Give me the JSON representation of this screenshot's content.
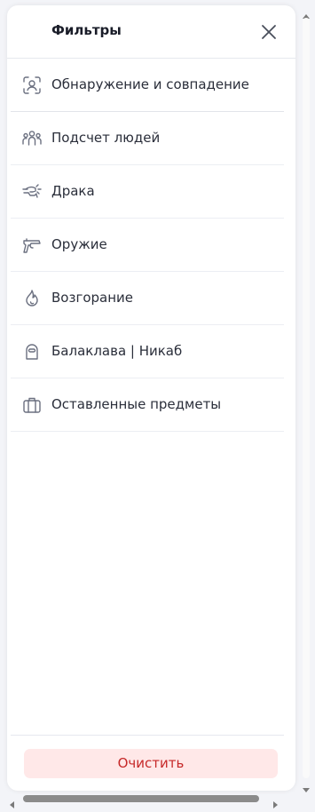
{
  "panel": {
    "title": "Фильтры",
    "close_icon": "close-icon"
  },
  "filters": [
    {
      "label": "Обнаружение и совпадение",
      "icon": "face-scan-icon"
    },
    {
      "label": "Подсчет людей",
      "icon": "people-group-icon"
    },
    {
      "label": "Драка",
      "icon": "fight-fist-icon"
    },
    {
      "label": "Оружие",
      "icon": "pistol-icon"
    },
    {
      "label": "Возгорание",
      "icon": "flame-icon"
    },
    {
      "label": "Балаклава | Никаб",
      "icon": "balaclava-icon"
    },
    {
      "label": "Оставленные предметы",
      "icon": "suitcase-icon"
    }
  ],
  "footer": {
    "clear_label": "Очистить"
  },
  "colors": {
    "clear_text": "#c62828",
    "clear_bg": "#ffe8e8",
    "icon_stroke": "#6b7080"
  }
}
